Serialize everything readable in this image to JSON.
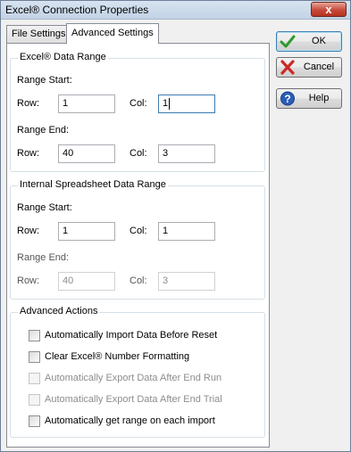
{
  "window": {
    "title": "Excel® Connection Properties",
    "close_glyph": "x"
  },
  "tabs": [
    {
      "label": "File Settings",
      "active": false
    },
    {
      "label": "Advanced Settings",
      "active": true
    }
  ],
  "excel_range": {
    "title": "Excel® Data Range",
    "start_label": "Range Start:",
    "end_label": "Range End:",
    "row_label": "Row:",
    "col_label": "Col:",
    "start_row": "1",
    "start_col": "1",
    "end_row": "40",
    "end_col": "3"
  },
  "internal_range": {
    "title": "Internal Spreadsheet Data Range",
    "start_label": "Range Start:",
    "end_label": "Range End:",
    "row_label": "Row:",
    "col_label": "Col:",
    "start_row": "1",
    "start_col": "1",
    "end_row": "40",
    "end_col": "3"
  },
  "advanced_actions": {
    "title": "Advanced Actions",
    "options": [
      {
        "label": "Automatically Import Data Before Reset",
        "checked": false,
        "enabled": true
      },
      {
        "label": "Clear Excel® Number Formatting",
        "checked": false,
        "enabled": true
      },
      {
        "label": "Automatically Export Data After End Run",
        "checked": false,
        "enabled": false
      },
      {
        "label": "Automatically Export Data After End Trial",
        "checked": false,
        "enabled": false
      },
      {
        "label": "Automatically get range on each import",
        "checked": false,
        "enabled": true
      }
    ]
  },
  "buttons": {
    "ok": "OK",
    "cancel": "Cancel",
    "help": "Help"
  },
  "icons": {
    "ok": "checkmark-icon",
    "cancel": "red-x-icon",
    "help": "question-icon"
  },
  "colors": {
    "ok_green": "#2e9a2e",
    "cancel_red": "#cc2a24",
    "help_blue": "#2a5db8"
  }
}
